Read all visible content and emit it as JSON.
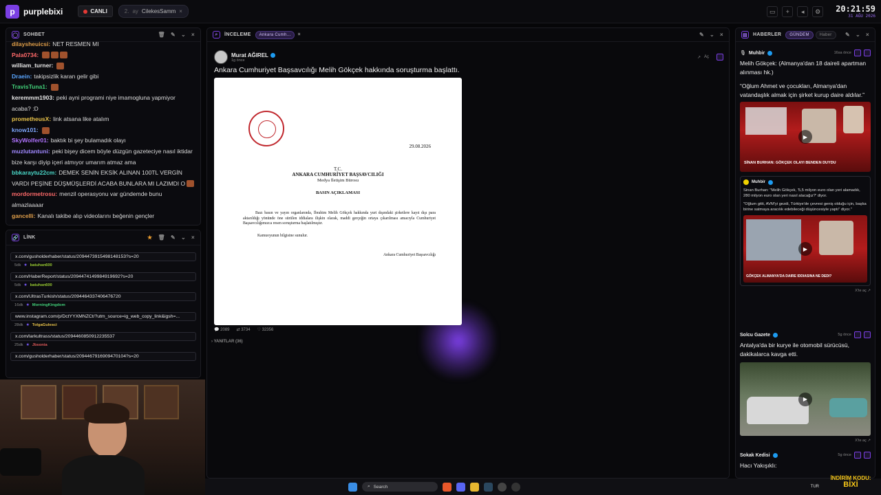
{
  "topbar": {
    "brand": "purplebixi",
    "live_label": "CANLI",
    "channel_num": "2.",
    "channel_pre": "ay",
    "channel_name": "CilekesSamm",
    "time": "20:21:59",
    "date": "31 AĞU 2026"
  },
  "chat": {
    "title": "SOHBET",
    "messages": [
      {
        "user": "dilaysheuicsi:",
        "text": "NET RESMEN MI",
        "color": "#e2a04a"
      },
      {
        "user": "Pala0734:",
        "text": "",
        "color": "#ff6a6a",
        "emotes": 3
      },
      {
        "user": "william_turner:",
        "text": "",
        "color": "#e9e9e9",
        "emotes": 1
      },
      {
        "user": "Draein:",
        "text": "takipsizlik karan gelir gibi",
        "color": "#5aa6ff"
      },
      {
        "user": "TravisTuna1:",
        "text": "",
        "color": "#42d17a",
        "emotes": 1
      },
      {
        "user": "keremmm1903:",
        "text": "peki ayni programi niye imamogluna yapmiyor acaba? :D",
        "color": "#e9e9e9"
      },
      {
        "user": "prometheusX:",
        "text": "link atsana like atalım",
        "color": "#e9c34a"
      },
      {
        "user": "know101:",
        "text": "",
        "color": "#7fa8ff",
        "emotes": 1
      },
      {
        "user": "SkyWolfer01:",
        "text": "baktık bi şey bulamadık olayı",
        "color": "#b073ff"
      },
      {
        "user": "muzlutantuni:",
        "text": "peki bişey dicem böyle düzgün gazeteciye nasıl iktidar bize karşı diyip içeri atmıyor umarım atmaz ama",
        "color": "#a088ff"
      },
      {
        "user": "bbkaraytu22cm:",
        "text": "DEMEK SENİN EKSİK ALINAN 100TL VERGİN VARDI PEŞİNE DÜŞMÜŞLERDİ ACABA BUNLARA MI LAZIMDI O",
        "color": "#4ad8c8",
        "emotes": 1
      },
      {
        "user": "mordormetrosu:",
        "text": "menzil operasyonu var gündemde bunu almazlaaaar",
        "color": "#ff6a6a"
      },
      {
        "user": "gancelli:",
        "text": "Kanalı takibe alıp videolarını beğenin gençler",
        "color": "#e2a04a"
      }
    ]
  },
  "links": {
    "title": "LİNK",
    "items": [
      {
        "url": "x.com/gusholderhaber/status/2094473915498148153?s=20",
        "age": "5dk",
        "user": "batuhan600",
        "ucolor": "#9acd32"
      },
      {
        "url": "x.com/HaberReport/status/2094474149984919692?s=20",
        "age": "5dk",
        "user": "batuhan600",
        "ucolor": "#9acd32"
      },
      {
        "url": "x.com/UltrasTurkish/status/2094464337406476720",
        "age": "16dk",
        "user": "MorningKingdom",
        "ucolor": "#42d17a"
      },
      {
        "url": "www.instagram.com/p/DctYYXMNZCt/?utm_source=ig_web_copy_link&igsh=...",
        "age": "28dk",
        "user": "TolgaGulesci",
        "ucolor": "#e9c34a"
      },
      {
        "url": "x.com/larkultrass/status/2094460850912235537",
        "age": "25dk",
        "user": "Jbsonia",
        "ucolor": "#e05a5a"
      },
      {
        "url": "x.com/gusholderhaber/status/2094467916909470104?s=20",
        "age": "",
        "user": "",
        "ucolor": "#888"
      }
    ]
  },
  "review": {
    "title": "İNCELEME",
    "tag": "Ankara Cumh...",
    "author": "Murat AĞIREL",
    "ago": "1g önce",
    "open_label": "Aç",
    "tweet": "Ankara Cumhuriyet Başsavcılığı Melih Gökçek hakkında soruşturma başlattı.",
    "stats": {
      "replies": "2089",
      "retweets": "3734",
      "likes": "32356"
    },
    "replies_label": "YANITLAR (36)",
    "doc": {
      "date": "29.08.2026",
      "tc": "T.C.",
      "org": "ANKARA CUMHURİYET BAŞSAVCILIĞI",
      "office": "Medya İletişim Bürosu",
      "heading": "BASIN AÇIKLAMASI",
      "body": "Bazı basın ve yayın organlarında, İbrahim Melih Gökçek hakkında yurt dışındaki şirketlere kayıt dışı para aktarıldığı yönünde öne sürülen iddialara ilişkin olarak, maddi gerçeğin ortaya çıkarılması amacıyla Cumhuriyet Başsavcılığımızca resen soruşturma başlatılmıştır.",
      "closing": "Kamuoyunun bilgisine sunulur.",
      "signature": "Ankara Cumhuriyet Başsavcılığı"
    }
  },
  "news": {
    "title": "HABERLER",
    "tab1": "GÜNDEM",
    "tab2": "Haber",
    "items": [
      {
        "source": "Muhbir",
        "time": "16sa önce",
        "text": "Melih Gökçek: (Almanya'dan 18 daireli apartman alınması hk.)",
        "quote": "“Oğlum Ahmet ve çocukları, Almanya'dan vatandaşlık almak için şirket kurup daire aldılar.”",
        "caption1": "SİNAN BURHAN: GÖKÇEK OLAYI BENDEN DUYDU",
        "qsource": "Muhbir",
        "qtext1": "Sinan Burhan: \"Melih Gökçek, '5,5 milyon euro olan yeri alamadık, 280 milyon euro olan yeri nasıl alacağız?' diyor.",
        "qtext2": "\"Oğlum gitti, AVM'yi gezdi, Türkiye'de çevresi geniş olduğu için, başka birine satmaya aracılık edebileceği düşüncesiyle yaptı\" diyor.\"",
        "caption2": "GÖKÇEK ALMANYA'DA DAIRE IDDIASINA NE DEDI?",
        "open": "X'te aç"
      },
      {
        "source": "Solcu Gazete",
        "time": "5g önce",
        "text": "Antalya'da bir kurye ile otomobil sürücüsü, dakikalarca kavga etti.",
        "open": "X'te aç"
      },
      {
        "source": "Sokak Kedisi",
        "time": "5g önce",
        "text": "Hacı Yakışıklı:"
      }
    ]
  },
  "taskbar": {
    "search": "Search",
    "lang": "TUR"
  },
  "overlay": {
    "brand_top": "İNDİRİM KODU:",
    "brand_bottom": "BİXİ"
  }
}
